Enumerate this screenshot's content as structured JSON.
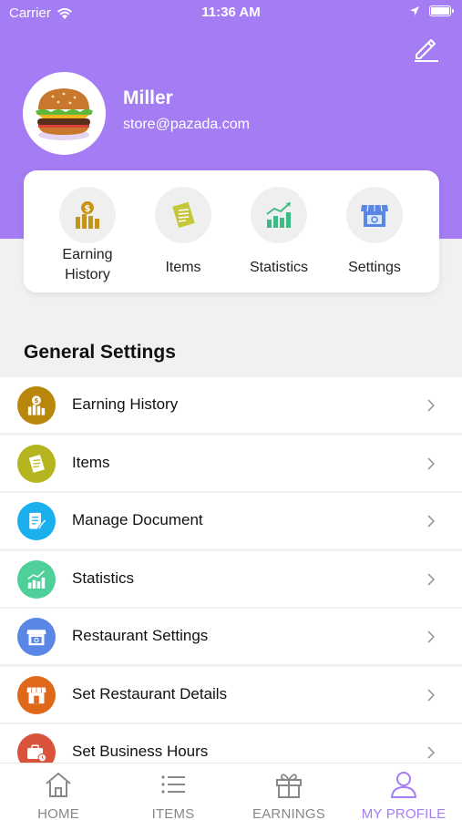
{
  "status": {
    "carrier": "Carrier",
    "time": "11:36 AM",
    "battery_level": 1.0
  },
  "profile": {
    "name": "Miller",
    "email": "store@pazada.com"
  },
  "quick_actions": [
    {
      "label": "Earning History",
      "icon": "earnings-icon"
    },
    {
      "label": "Items",
      "icon": "receipt-icon"
    },
    {
      "label": "Statistics",
      "icon": "chart-icon"
    },
    {
      "label": "Settings",
      "icon": "store-icon"
    }
  ],
  "section_title": "General Settings",
  "settings_list": [
    {
      "label": "Earning History",
      "icon": "earnings-icon",
      "color": "#b8860b"
    },
    {
      "label": "Items",
      "icon": "receipt-icon",
      "color": "#b5b520"
    },
    {
      "label": "Manage Document",
      "icon": "document-icon",
      "color": "#1ab0ee"
    },
    {
      "label": "Statistics",
      "icon": "chart-icon",
      "color": "#4fcf9a"
    },
    {
      "label": "Restaurant Settings",
      "icon": "store-icon",
      "color": "#5a86e6"
    },
    {
      "label": "Set Restaurant Details",
      "icon": "storefront-icon",
      "color": "#e0681b"
    },
    {
      "label": "Set Business Hours",
      "icon": "briefcase-clock-icon",
      "color": "#d9533b"
    }
  ],
  "bottom_nav": [
    {
      "label": "HOME",
      "icon": "home-icon",
      "active": false
    },
    {
      "label": "ITEMS",
      "icon": "list-icon",
      "active": false
    },
    {
      "label": "EARNINGS",
      "icon": "gift-icon",
      "active": false
    },
    {
      "label": "MY PROFILE",
      "icon": "user-icon",
      "active": true
    }
  ],
  "colors": {
    "accent": "#a47cf3",
    "background": "#f1f1f3"
  }
}
